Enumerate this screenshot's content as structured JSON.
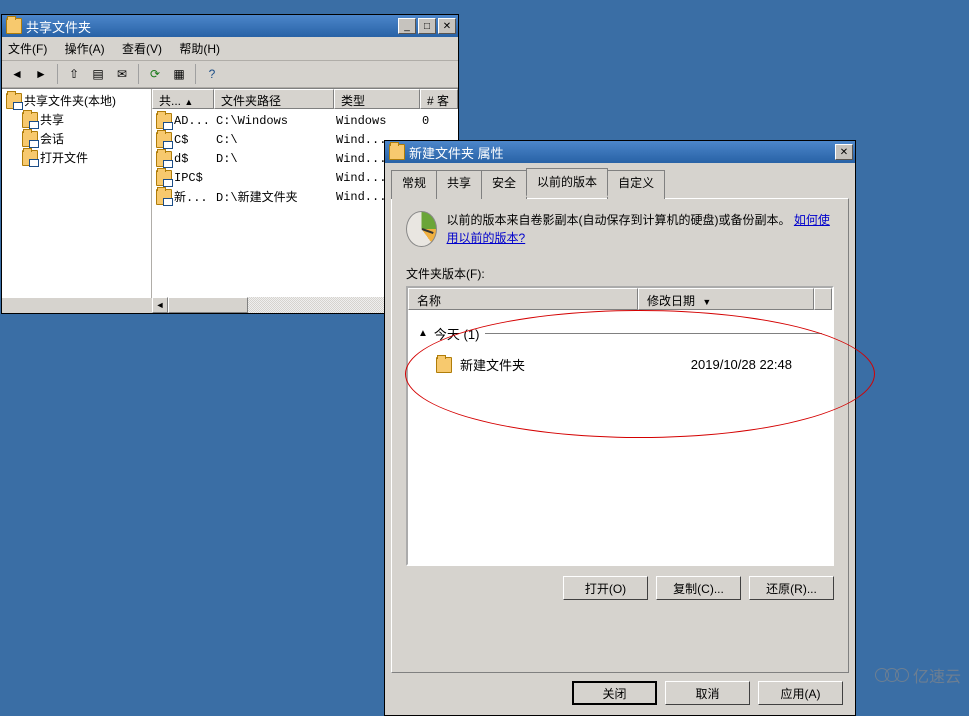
{
  "mmc": {
    "title": "共享文件夹",
    "menus": {
      "file": "文件(F)",
      "action": "操作(A)",
      "view": "查看(V)",
      "help": "帮助(H)"
    },
    "tree": {
      "root": "共享文件夹(本地)",
      "children": [
        {
          "label": "共享"
        },
        {
          "label": "会话"
        },
        {
          "label": "打开文件"
        }
      ]
    },
    "columns": {
      "name": "共...",
      "path": "文件夹路径",
      "type": "类型",
      "ext": "# 客"
    },
    "rows": [
      {
        "name": "AD...",
        "path": "C:\\Windows",
        "type": "Windows",
        "ext": "0"
      },
      {
        "name": "C$",
        "path": "C:\\",
        "type": "Wind...",
        "ext": ""
      },
      {
        "name": "d$",
        "path": "D:\\",
        "type": "Wind...",
        "ext": ""
      },
      {
        "name": "IPC$",
        "path": "",
        "type": "Wind...",
        "ext": ""
      },
      {
        "name": "新...",
        "path": "D:\\新建文件夹",
        "type": "Wind...",
        "ext": ""
      }
    ],
    "sort_arrow": "▲"
  },
  "dlg": {
    "title": "新建文件夹 属性",
    "tabs": {
      "general": "常规",
      "share": "共享",
      "security": "安全",
      "prev": "以前的版本",
      "custom": "自定义"
    },
    "info_prefix": "以前的版本来自卷影副本(自动保存到计算机的硬盘)或备份副本。",
    "info_link": "如何使用以前的版本?",
    "list_label": "文件夹版本(F):",
    "columns": {
      "name": "名称",
      "date": "修改日期"
    },
    "group": "今天 (1)",
    "group_arrow": "▲",
    "items": [
      {
        "name": "新建文件夹",
        "date": "2019/10/28 22:48"
      }
    ],
    "buttons": {
      "open": "打开(O)",
      "copy": "复制(C)...",
      "restore": "还原(R)..."
    },
    "footer": {
      "close": "关闭",
      "cancel": "取消",
      "apply": "应用(A)"
    }
  },
  "watermark": "亿速云"
}
